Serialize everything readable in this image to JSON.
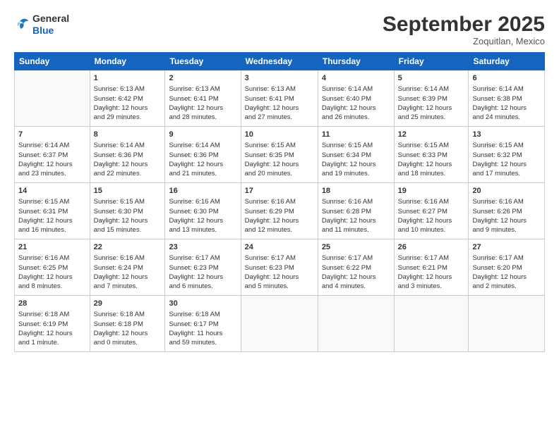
{
  "header": {
    "logo_line1": "General",
    "logo_line2": "Blue",
    "month": "September 2025",
    "location": "Zoquitlan, Mexico"
  },
  "days_of_week": [
    "Sunday",
    "Monday",
    "Tuesday",
    "Wednesday",
    "Thursday",
    "Friday",
    "Saturday"
  ],
  "weeks": [
    [
      {
        "day": "",
        "info": ""
      },
      {
        "day": "1",
        "info": "Sunrise: 6:13 AM\nSunset: 6:42 PM\nDaylight: 12 hours\nand 29 minutes."
      },
      {
        "day": "2",
        "info": "Sunrise: 6:13 AM\nSunset: 6:41 PM\nDaylight: 12 hours\nand 28 minutes."
      },
      {
        "day": "3",
        "info": "Sunrise: 6:13 AM\nSunset: 6:41 PM\nDaylight: 12 hours\nand 27 minutes."
      },
      {
        "day": "4",
        "info": "Sunrise: 6:14 AM\nSunset: 6:40 PM\nDaylight: 12 hours\nand 26 minutes."
      },
      {
        "day": "5",
        "info": "Sunrise: 6:14 AM\nSunset: 6:39 PM\nDaylight: 12 hours\nand 25 minutes."
      },
      {
        "day": "6",
        "info": "Sunrise: 6:14 AM\nSunset: 6:38 PM\nDaylight: 12 hours\nand 24 minutes."
      }
    ],
    [
      {
        "day": "7",
        "info": "Sunrise: 6:14 AM\nSunset: 6:37 PM\nDaylight: 12 hours\nand 23 minutes."
      },
      {
        "day": "8",
        "info": "Sunrise: 6:14 AM\nSunset: 6:36 PM\nDaylight: 12 hours\nand 22 minutes."
      },
      {
        "day": "9",
        "info": "Sunrise: 6:14 AM\nSunset: 6:36 PM\nDaylight: 12 hours\nand 21 minutes."
      },
      {
        "day": "10",
        "info": "Sunrise: 6:15 AM\nSunset: 6:35 PM\nDaylight: 12 hours\nand 20 minutes."
      },
      {
        "day": "11",
        "info": "Sunrise: 6:15 AM\nSunset: 6:34 PM\nDaylight: 12 hours\nand 19 minutes."
      },
      {
        "day": "12",
        "info": "Sunrise: 6:15 AM\nSunset: 6:33 PM\nDaylight: 12 hours\nand 18 minutes."
      },
      {
        "day": "13",
        "info": "Sunrise: 6:15 AM\nSunset: 6:32 PM\nDaylight: 12 hours\nand 17 minutes."
      }
    ],
    [
      {
        "day": "14",
        "info": "Sunrise: 6:15 AM\nSunset: 6:31 PM\nDaylight: 12 hours\nand 16 minutes."
      },
      {
        "day": "15",
        "info": "Sunrise: 6:15 AM\nSunset: 6:30 PM\nDaylight: 12 hours\nand 15 minutes."
      },
      {
        "day": "16",
        "info": "Sunrise: 6:16 AM\nSunset: 6:30 PM\nDaylight: 12 hours\nand 13 minutes."
      },
      {
        "day": "17",
        "info": "Sunrise: 6:16 AM\nSunset: 6:29 PM\nDaylight: 12 hours\nand 12 minutes."
      },
      {
        "day": "18",
        "info": "Sunrise: 6:16 AM\nSunset: 6:28 PM\nDaylight: 12 hours\nand 11 minutes."
      },
      {
        "day": "19",
        "info": "Sunrise: 6:16 AM\nSunset: 6:27 PM\nDaylight: 12 hours\nand 10 minutes."
      },
      {
        "day": "20",
        "info": "Sunrise: 6:16 AM\nSunset: 6:26 PM\nDaylight: 12 hours\nand 9 minutes."
      }
    ],
    [
      {
        "day": "21",
        "info": "Sunrise: 6:16 AM\nSunset: 6:25 PM\nDaylight: 12 hours\nand 8 minutes."
      },
      {
        "day": "22",
        "info": "Sunrise: 6:16 AM\nSunset: 6:24 PM\nDaylight: 12 hours\nand 7 minutes."
      },
      {
        "day": "23",
        "info": "Sunrise: 6:17 AM\nSunset: 6:23 PM\nDaylight: 12 hours\nand 6 minutes."
      },
      {
        "day": "24",
        "info": "Sunrise: 6:17 AM\nSunset: 6:23 PM\nDaylight: 12 hours\nand 5 minutes."
      },
      {
        "day": "25",
        "info": "Sunrise: 6:17 AM\nSunset: 6:22 PM\nDaylight: 12 hours\nand 4 minutes."
      },
      {
        "day": "26",
        "info": "Sunrise: 6:17 AM\nSunset: 6:21 PM\nDaylight: 12 hours\nand 3 minutes."
      },
      {
        "day": "27",
        "info": "Sunrise: 6:17 AM\nSunset: 6:20 PM\nDaylight: 12 hours\nand 2 minutes."
      }
    ],
    [
      {
        "day": "28",
        "info": "Sunrise: 6:18 AM\nSunset: 6:19 PM\nDaylight: 12 hours\nand 1 minute."
      },
      {
        "day": "29",
        "info": "Sunrise: 6:18 AM\nSunset: 6:18 PM\nDaylight: 12 hours\nand 0 minutes."
      },
      {
        "day": "30",
        "info": "Sunrise: 6:18 AM\nSunset: 6:17 PM\nDaylight: 11 hours\nand 59 minutes."
      },
      {
        "day": "",
        "info": ""
      },
      {
        "day": "",
        "info": ""
      },
      {
        "day": "",
        "info": ""
      },
      {
        "day": "",
        "info": ""
      }
    ]
  ]
}
